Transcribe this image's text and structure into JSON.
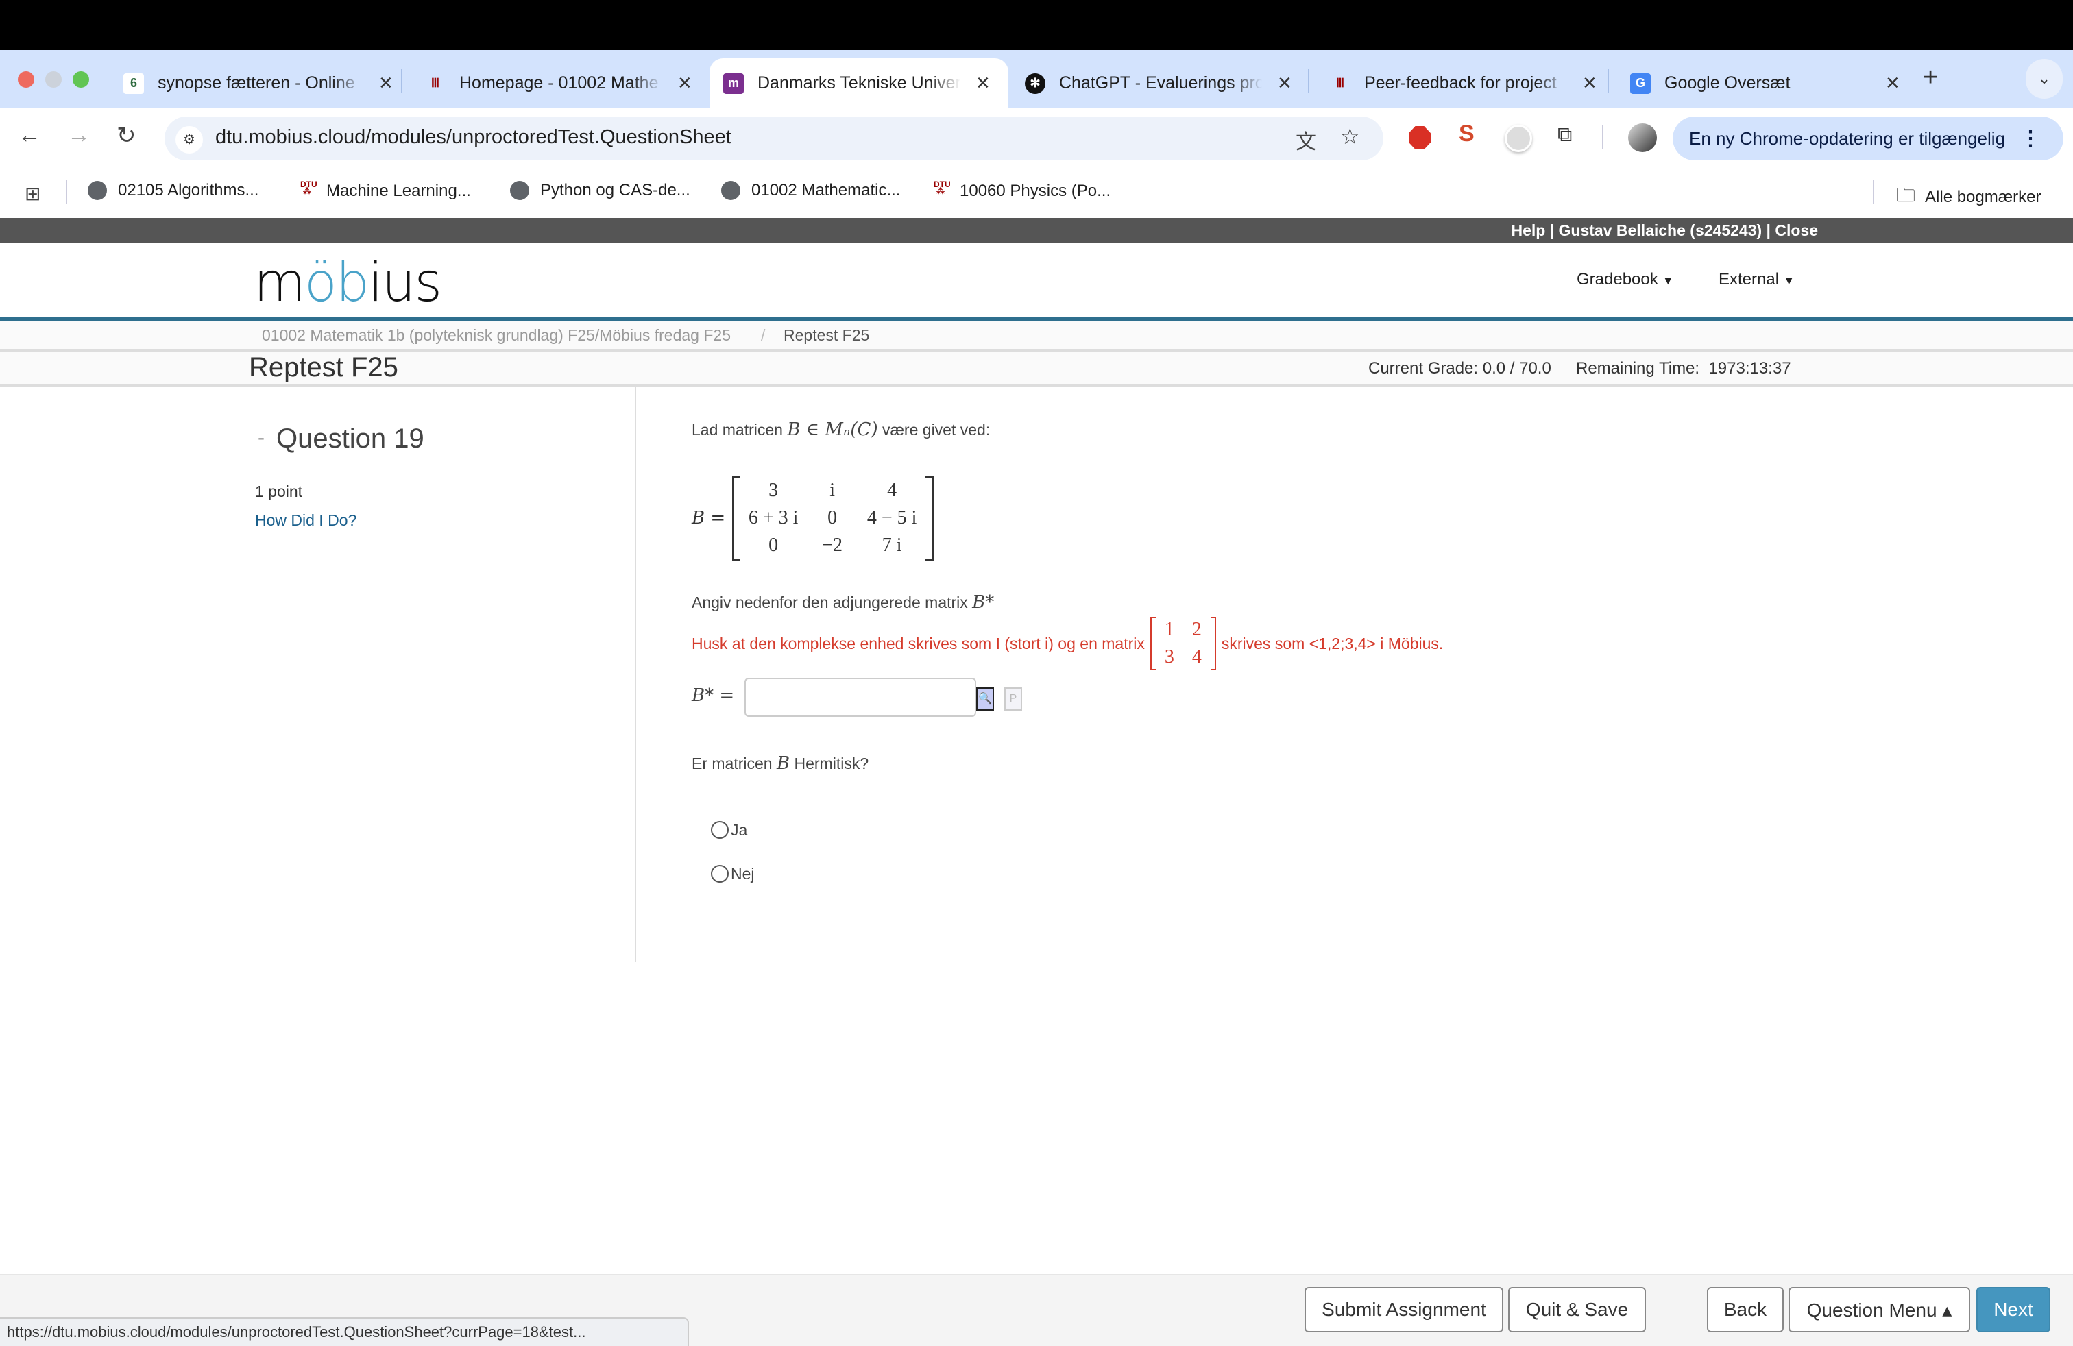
{
  "browser": {
    "tabs": [
      {
        "title": "synopse fætteren - Online",
        "icon": "overleaf-icon"
      },
      {
        "title": "Homepage - 01002 Mathe",
        "icon": "dtu-icon"
      },
      {
        "title": "Danmarks Tekniske Univer",
        "icon": "mobius-icon",
        "active": true
      },
      {
        "title": "ChatGPT - Evaluerings pro",
        "icon": "chatgpt-icon"
      },
      {
        "title": "Peer-feedback for project",
        "icon": "dtu-icon"
      },
      {
        "title": "Google Oversæt",
        "icon": "google-translate-icon"
      }
    ],
    "url": "dtu.mobius.cloud/modules/unproctoredTest.QuestionSheet",
    "update_label": "En ny Chrome-opdatering er tilgængelig",
    "bookmarks": [
      {
        "label": "02105 Algorithms...",
        "icon": "globe"
      },
      {
        "label": "Machine Learning...",
        "icon": "dtu"
      },
      {
        "label": "Python og CAS-de...",
        "icon": "globe"
      },
      {
        "label": "01002 Mathematic...",
        "icon": "globe"
      },
      {
        "label": "10060 Physics (Po...",
        "icon": "dtu"
      }
    ],
    "all_bookmarks": "Alle bogmærker",
    "status_url": "https://dtu.mobius.cloud/modules/unproctoredTest.QuestionSheet?currPage=18&test..."
  },
  "mobius": {
    "topbar": "Help | Gustav Bellaiche (s245243) | Close",
    "logo": "möbius",
    "menu": {
      "gradebook": "Gradebook",
      "external": "External"
    },
    "breadcrumb": [
      "01002 Matematik 1b (polyteknisk grundlag) F25/Möbius fredag F25",
      "Reptest F25"
    ],
    "breadcrumb_sep": "/",
    "title": "Reptest F25",
    "grade": "Current Grade: 0.0 / 70.0",
    "remaining_label": "Remaining Time:",
    "remaining_value": "1973:13:37"
  },
  "question": {
    "dash": "-",
    "title": "Question 19",
    "points": "1 point",
    "how_did_i_do": "How Did I Do?",
    "intro_pre": "Lad matricen",
    "intro_math": "B ∈ Mₙ(C)",
    "intro_post": "være givet ved:",
    "matrix_label": "B =",
    "matrix": [
      "3",
      "i",
      "4",
      "6 + 3 i",
      "0",
      "4 − 5 i",
      "0",
      "−2",
      "7 i"
    ],
    "angiv": "Angiv nedenfor den adjungerede matrix",
    "angiv_math": "B*",
    "hint_pre": "Husk at den komplekse enhed skrives som I (stort i) og en matrix",
    "hint_matrix": [
      "1",
      "2",
      "3",
      "4"
    ],
    "hint_post": "skrives som  <1,2;3,4> i Möbius.",
    "input_label": "B* =",
    "input_value": "",
    "hermitian_pre": "Er matricen",
    "hermitian_math": "B",
    "hermitian_post": "Hermitisk?",
    "options": [
      "Ja",
      "Nej"
    ]
  },
  "footer": {
    "submit": "Submit Assignment",
    "quit": "Quit & Save",
    "back": "Back",
    "question_menu": "Question Menu ▴",
    "next": "Next"
  },
  "colors": {
    "accent": "#4596bf",
    "brand_line": "#2e6f8e",
    "hint": "#d53b2c",
    "link": "#1a5f8c"
  }
}
